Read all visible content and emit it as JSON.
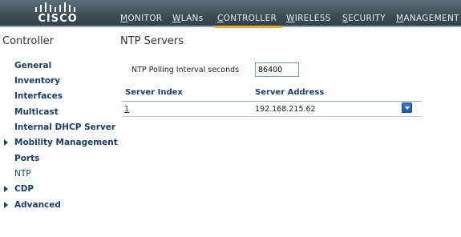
{
  "brand": {
    "logo_text": "CISCO"
  },
  "nav": {
    "items": [
      {
        "label_ul": "M",
        "label_rest": "ONITOR"
      },
      {
        "label_ul": "W",
        "label_rest": "LANs"
      },
      {
        "label_ul": "C",
        "label_rest": "ONTROLLER",
        "active": true
      },
      {
        "label_ul": "W",
        "label_rest": "IRELESS"
      },
      {
        "label_ul": "S",
        "label_rest": "ECURITY"
      },
      {
        "label_ul": "M",
        "label_rest": "ANAGEMENT"
      }
    ]
  },
  "sidebar": {
    "title": "Controller",
    "items": [
      {
        "label": "General",
        "expandable": false
      },
      {
        "label": "Inventory",
        "expandable": false
      },
      {
        "label": "Interfaces",
        "expandable": false
      },
      {
        "label": "Multicast",
        "expandable": false
      },
      {
        "label": "Internal DHCP Server",
        "expandable": false
      },
      {
        "label": "Mobility Management",
        "expandable": true
      },
      {
        "label": "Ports",
        "expandable": false
      },
      {
        "label": "NTP",
        "expandable": false,
        "current": true
      },
      {
        "label": "CDP",
        "expandable": true
      },
      {
        "label": "Advanced",
        "expandable": true
      }
    ]
  },
  "main": {
    "title": "NTP Servers",
    "polling": {
      "label": "NTP Polling Interval seconds",
      "value": "86400"
    },
    "table": {
      "headers": {
        "index": "Server Index",
        "address": "Server Address"
      },
      "rows": [
        {
          "index": "1",
          "address": "192.168.215.62"
        }
      ]
    }
  },
  "colors": {
    "topbar": "#3e4d55",
    "active_tab_underline": "#f0a830",
    "link": "#1b3d6b",
    "dropdown_button": "#1f5aa8"
  }
}
